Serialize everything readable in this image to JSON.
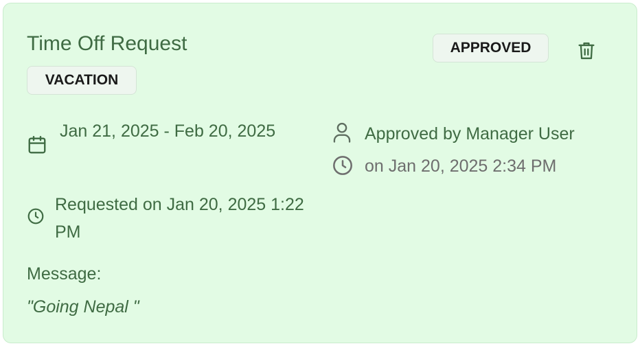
{
  "card": {
    "title": "Time Off Request",
    "type_badge": "VACATION",
    "status_badge": "APPROVED",
    "date_range": "Jan 21, 2025 - Feb 20, 2025",
    "requested": "Requested on Jan 20, 2025 1:22 PM",
    "approved_by": "Approved by Manager User",
    "approved_on": "on Jan 20, 2025 2:34 PM",
    "message_label": "Message:",
    "message": "\"Going Nepal \""
  },
  "icons": {
    "delete": "trash-icon",
    "date": "calendar-icon",
    "requested": "clock-icon",
    "approver": "user-icon",
    "approved_time": "clock-icon"
  },
  "colors": {
    "card_bg": "#e2fbe4",
    "card_border": "#c9eccc",
    "text_green": "#3f6b43",
    "text_gray": "#6e6e6e",
    "badge_bg": "#eef6ef"
  }
}
